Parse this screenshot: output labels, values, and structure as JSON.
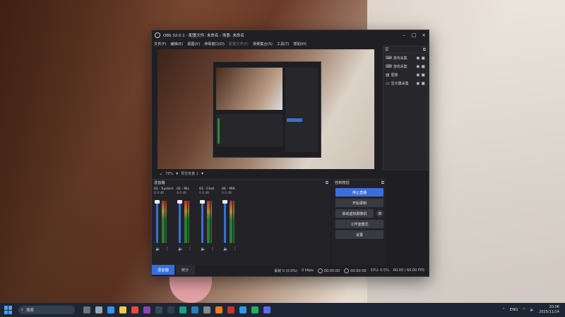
{
  "window": {
    "title": "OBS 32.0.1 - 配置文件: 未命名 - 场景: 未命名",
    "minimize": "–",
    "maximize": "□",
    "close": "×"
  },
  "menu": [
    "文件(F)",
    "编辑(E)",
    "视图(V)",
    "停靠窗口(D)",
    "配置文件(P)",
    "场景集合(S)",
    "工具(T)",
    "帮助(H)"
  ],
  "preview_toolbar": {
    "zoom": "78%",
    "scene_select": "预览变量 1"
  },
  "sources_panel": {
    "items": [
      {
        "label": "游戏采集",
        "icon": "gamepad-icon"
      },
      {
        "label": "游戏采集",
        "icon": "gamepad-icon"
      },
      {
        "label": "图像",
        "icon": "image-icon"
      },
      {
        "label": "显示器采集",
        "icon": "monitor-icon"
      }
    ]
  },
  "mixer": {
    "title": "混音器",
    "channels": [
      {
        "name": "01 - System",
        "db": "0.0 dB"
      },
      {
        "name": "02 - Mic",
        "db": "0.0 dB"
      },
      {
        "name": "03 - Chat",
        "db": "0.0 dB"
      },
      {
        "name": "06 - MIX",
        "db": "0.0 dB"
      }
    ],
    "scale": [
      "0",
      "-5",
      "-10",
      "-15",
      "-20",
      "-25",
      "-30",
      "-35",
      "-40",
      "-45",
      "-50",
      "-55",
      "-60"
    ]
  },
  "dock_tabs": {
    "mixer": "混音器",
    "stats": "统计"
  },
  "controls": {
    "title": "控制按钮",
    "stop_stream": "停止直播",
    "start_record": "开始录制",
    "start_virtualcam": "启动虚拟摄像机",
    "studio_mode": "工作室模式",
    "settings": "设置"
  },
  "status": {
    "dropped": "丢帧 0 (0.0%)",
    "bitrate": "0 kbps",
    "stream_time": "00:00:00",
    "rec_time": "00:00:00",
    "cpu": "CPU: 0.5%",
    "fps": "60.00 / 60.00 FPS"
  },
  "taskbar": {
    "search_placeholder": "搜索",
    "tray_lang": "ENG",
    "time": "20:06",
    "date": "2025/11/14"
  },
  "colors": {
    "accent": "#3a6fd8",
    "window_bg": "#1f1f23",
    "taskbar": "#1e2633"
  }
}
